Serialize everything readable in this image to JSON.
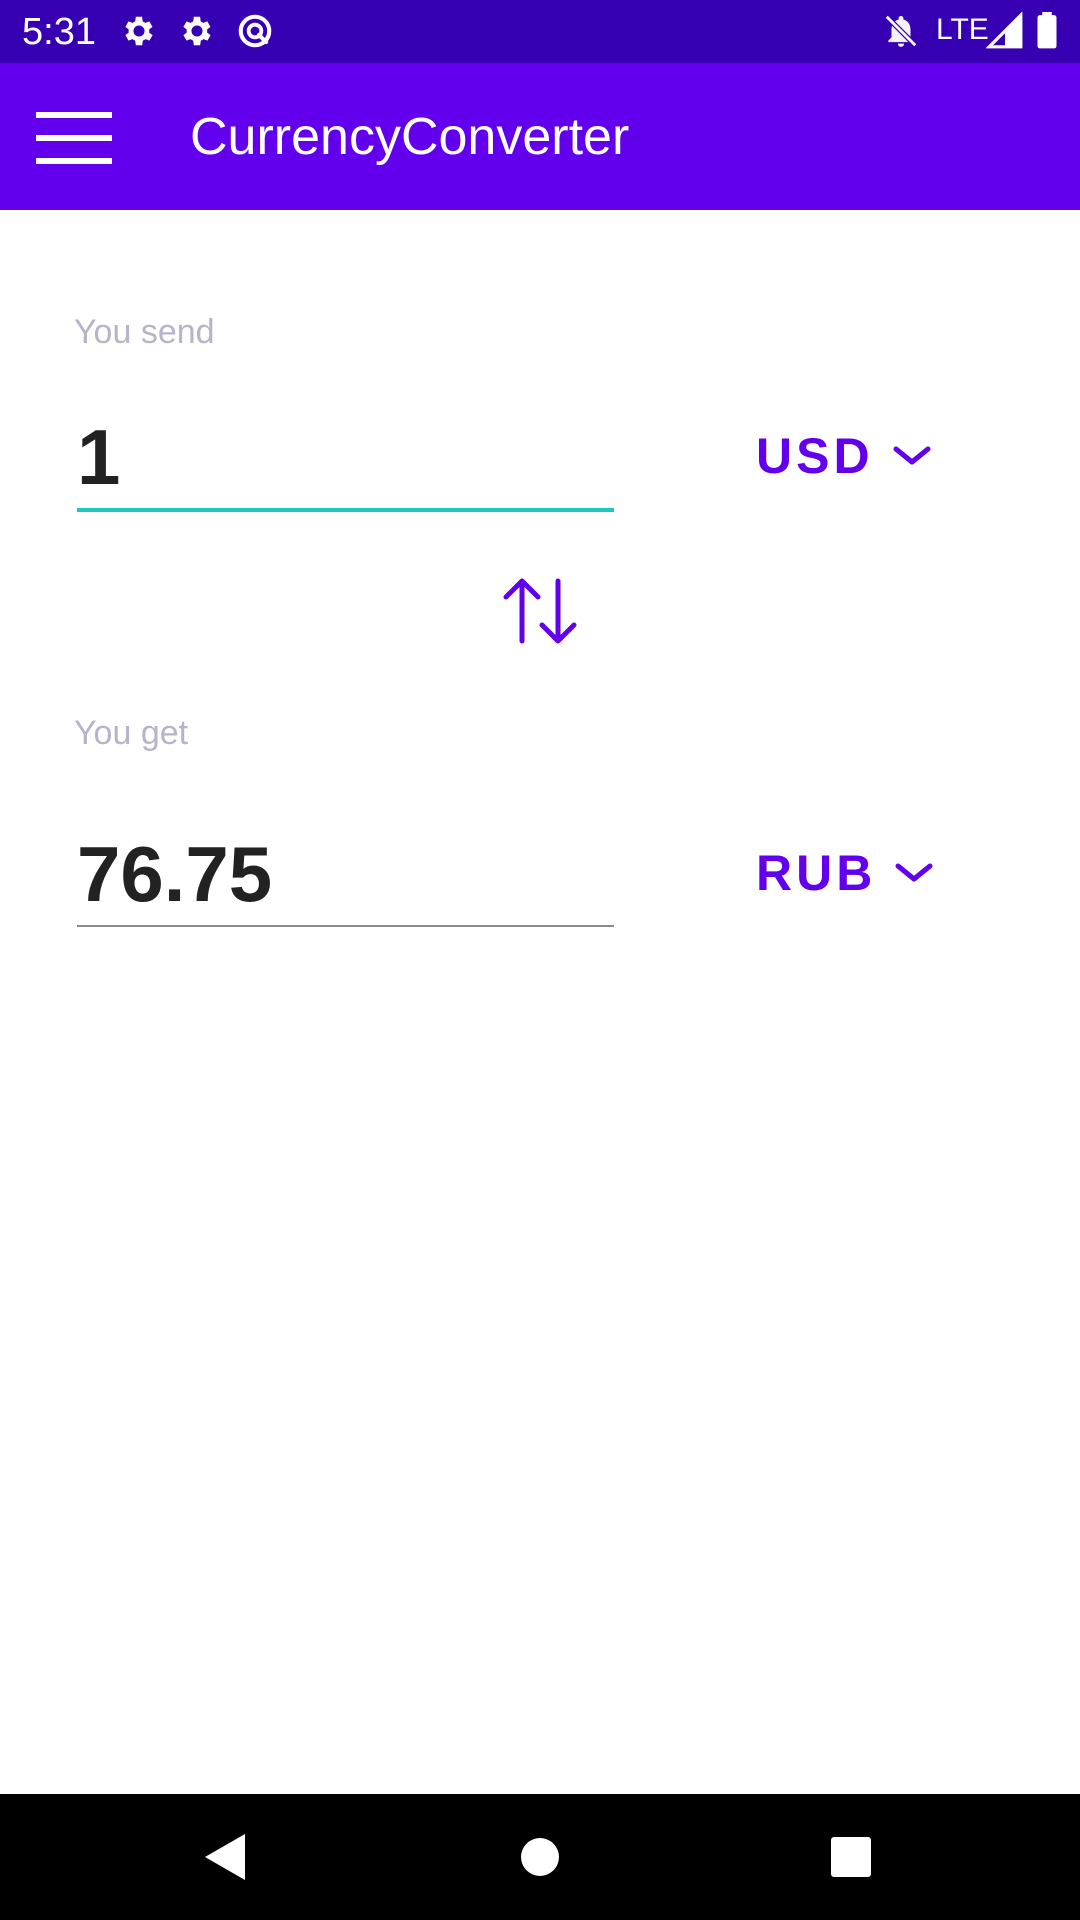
{
  "status_bar": {
    "time": "5:31",
    "network": "LTE",
    "icons": [
      "settings-icon",
      "settings-icon",
      "vpn-icon",
      "notifications-off-icon",
      "signal-icon",
      "battery-icon"
    ]
  },
  "app_bar": {
    "title": "CurrencyConverter",
    "menu_icon": "menu-icon"
  },
  "send": {
    "label": "You send",
    "amount": "1",
    "currency": "USD"
  },
  "get": {
    "label": "You get",
    "amount": "76.75",
    "currency": "RUB"
  },
  "swap_icon": "swap-vertical-icon",
  "colors": {
    "status_bar": "#3700b3",
    "app_bar": "#6200ee",
    "accent": "#6200ee",
    "focus_underline": "#1ec8c0",
    "label": "#b8b3c9",
    "nav_bar": "#000000"
  },
  "nav_bar": {
    "icons": [
      "back-icon",
      "home-icon",
      "recents-icon"
    ]
  }
}
